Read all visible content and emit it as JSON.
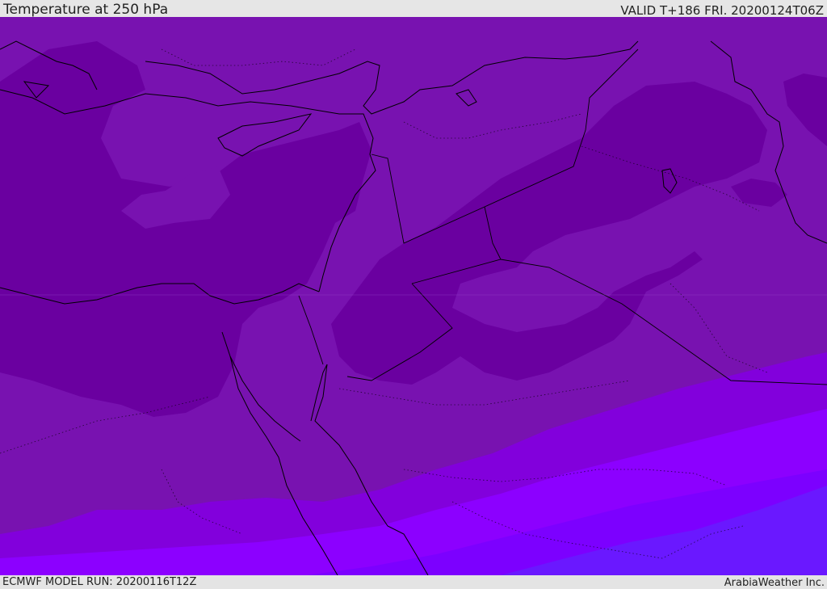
{
  "header": {
    "title": "Temperature at 250 hPa",
    "valid": "VALID T+186 FRI. 20200124T06Z"
  },
  "footer": {
    "model_run": "ECMWF MODEL RUN: 20200116T12Z",
    "credit": "ArabiaWeather Inc."
  },
  "map": {
    "variable": "Temperature",
    "level": "250 hPa",
    "colors": {
      "coldest": "#6a00a6",
      "cold": "#7810b0",
      "mid": "#8000dc",
      "warm": "#8c00ff",
      "warmer": "#7c00ff",
      "warmest": "#6a18ff",
      "borders": "#000000"
    }
  }
}
